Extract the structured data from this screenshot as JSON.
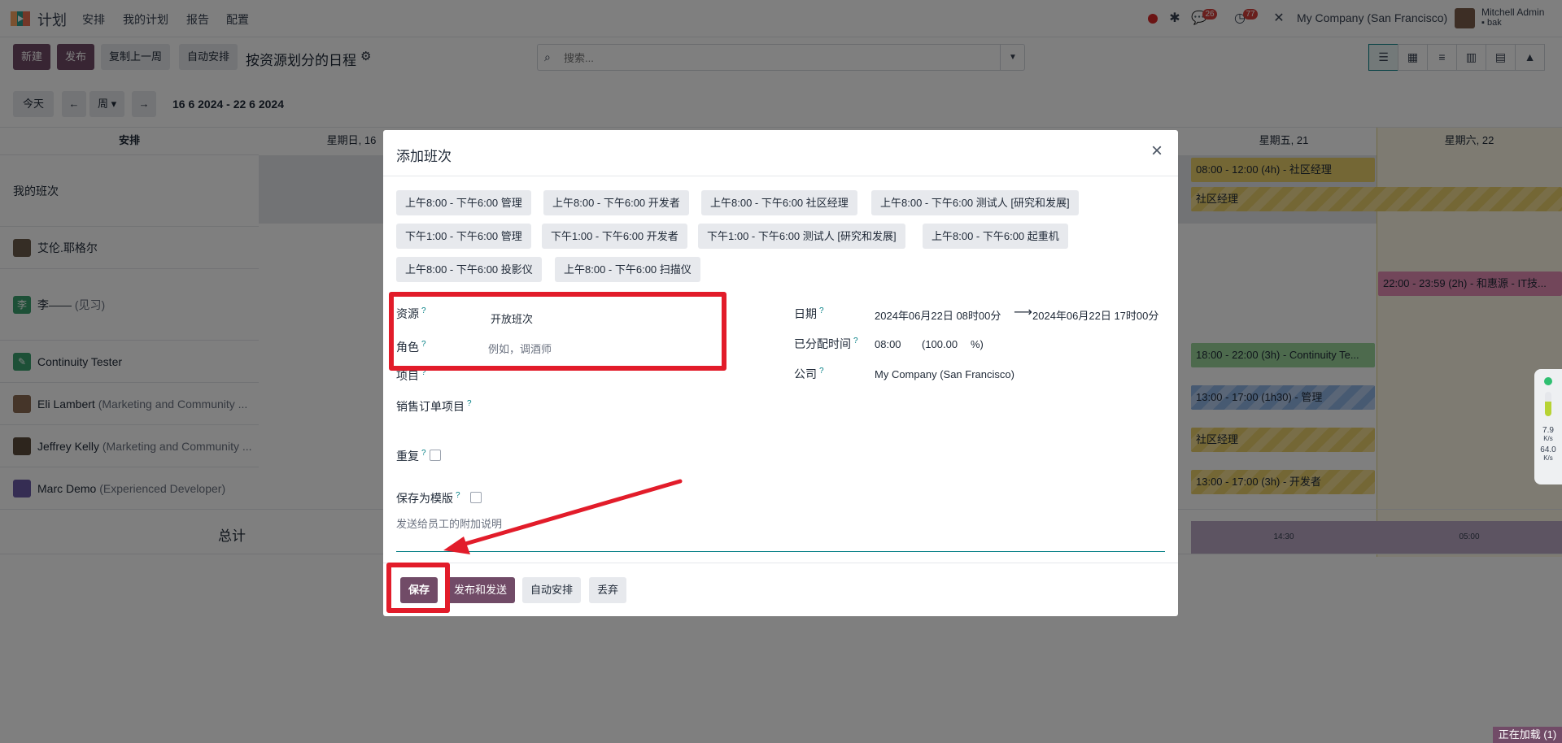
{
  "app": {
    "title": "计划"
  },
  "nav": {
    "items": [
      "安排",
      "我的计划",
      "报告",
      "配置"
    ]
  },
  "systray": {
    "messages_count": "26",
    "activities_count": "77",
    "company": "My Company (San Francisco)",
    "user_name": "Mitchell Admin",
    "user_db": "bak"
  },
  "controls": {
    "new": "新建",
    "publish": "发布",
    "copy_prev_week": "复制上一周",
    "auto_plan": "自动安排",
    "view_title": "按资源划分的日程",
    "search_placeholder": "搜索..."
  },
  "range": {
    "today": "今天",
    "scale": "周",
    "label": "16 6 2024 - 22 6 2024"
  },
  "gantt": {
    "col_header": "安排",
    "day_headers": [
      "星期日, 16",
      "星期五, 21",
      "星期六, 22"
    ],
    "rows": [
      {
        "name": "我的班次",
        "sub": ""
      },
      {
        "name": "艾伦.耶格尔",
        "sub": ""
      },
      {
        "name": "李——",
        "sub": "(见习)"
      },
      {
        "name": "Continuity Tester",
        "sub": ""
      },
      {
        "name": "Eli Lambert",
        "sub": "(Marketing and Community ..."
      },
      {
        "name": "Jeffrey Kelly",
        "sub": "(Marketing and Community ..."
      },
      {
        "name": "Marc Demo",
        "sub": "(Experienced Developer)"
      }
    ],
    "total_label": "总计",
    "totals": [
      "14:30",
      "05:00"
    ],
    "pills": [
      "08:00 - 12:00 (4h) - 社区经理",
      "社区经理",
      "22:00 - 23:59 (2h) - 和惠源 - IT技...",
      "18:00 - 22:00 (3h) - Continuity Te...",
      "13:00 - 17:00 (1h30) - 管理",
      "社区经理",
      "13:00 - 17:00 (3h) - 开发者"
    ]
  },
  "modal": {
    "title": "添加班次",
    "presets": [
      "上午8:00 - 下午6:00 管理",
      "上午8:00 - 下午6:00 开发者",
      "上午8:00 - 下午6:00 社区经理",
      "上午8:00 - 下午6:00 测试人 [研究和发展]",
      "下午1:00 - 下午6:00 管理",
      "下午1:00 - 下午6:00 开发者",
      "下午1:00 - 下午6:00 测试人 [研究和发展]",
      "上午8:00 - 下午6:00 起重机",
      "上午8:00 - 下午6:00 投影仪",
      "上午8:00 - 下午6:00 扫描仪"
    ],
    "fields": {
      "resource_label": "资源",
      "resource_value": "开放班次",
      "role_label": "角色",
      "role_placeholder": "例如，调酒师",
      "project_label": "项目",
      "sale_line_label": "销售订单项目",
      "repeat_label": "重复",
      "template_label": "保存为模版",
      "note_placeholder": "发送给员工的附加说明",
      "date_label": "日期",
      "date_start": "2024年06月22日 08时00分",
      "date_end": "2024年06月22日 17时00分",
      "allocated_label": "已分配时间",
      "allocated_hours": "08:00",
      "allocated_pct": "(100.00",
      "allocated_unit": "%)",
      "company_label": "公司",
      "company_value": "My Company (San Francisco)"
    },
    "buttons": {
      "save": "保存",
      "publish_send": "发布和发送",
      "auto_plan": "自动安排",
      "discard": "丢弃"
    }
  },
  "netmeter": {
    "up": "7.9",
    "up_unit": "K/s",
    "down": "64.0",
    "down_unit": "K/s"
  },
  "loading": "正在加载 (1)"
}
